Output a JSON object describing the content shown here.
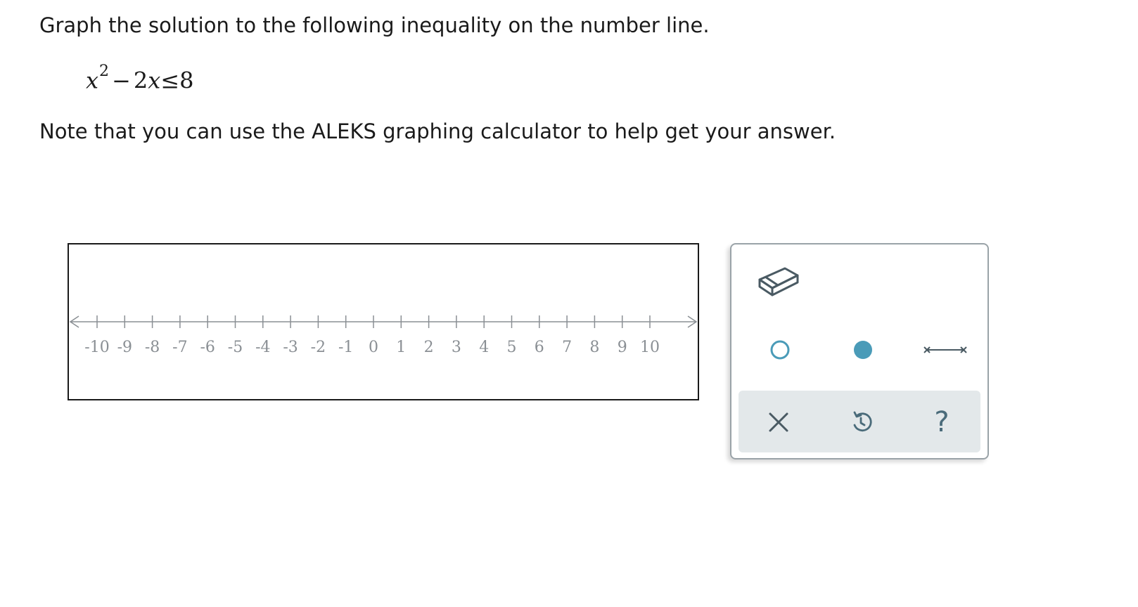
{
  "question": {
    "prompt": "Graph the solution to the following inequality on the number line.",
    "equation": {
      "base_var": "x",
      "exponent": "2",
      "minus": "−",
      "coef": "2",
      "var2": "x",
      "relation": "≤",
      "rhs": "8"
    },
    "note": "Note that you can use the ALEKS graphing calculator to help get your answer."
  },
  "number_line": {
    "min": -10,
    "max": 10,
    "tick_labels": [
      "-10",
      "-9",
      "-8",
      "-7",
      "-6",
      "-5",
      "-4",
      "-3",
      "-2",
      "-1",
      "0",
      "1",
      "2",
      "3",
      "4",
      "5",
      "6",
      "7",
      "8",
      "9",
      "10"
    ],
    "line_color": "#8a8f94",
    "label_color": "#8a8f94"
  },
  "toolbox": {
    "tools": [
      {
        "name": "eraser-tool",
        "icon": "eraser-icon"
      },
      {
        "name": "open-dot-tool",
        "icon": "open-circle-icon"
      },
      {
        "name": "closed-dot-tool",
        "icon": "filled-circle-icon"
      },
      {
        "name": "segment-tool",
        "icon": "segment-icon"
      }
    ],
    "actions": [
      {
        "name": "clear-button",
        "icon": "close-icon"
      },
      {
        "name": "undo-button",
        "icon": "undo-icon"
      },
      {
        "name": "help-button",
        "icon": "help-icon",
        "label": "?"
      }
    ],
    "accent_color": "#4a9bb8",
    "icon_color": "#4a6b7a",
    "action_bar_color": "#e3e8ea"
  }
}
